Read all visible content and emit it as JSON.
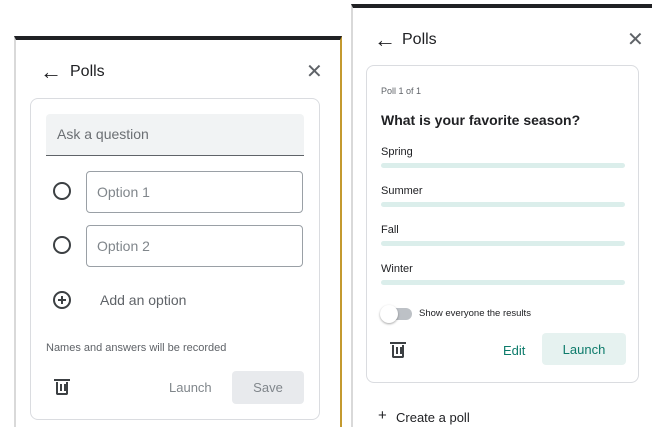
{
  "left_panel": {
    "title": "Polls",
    "back_icon": "←",
    "close_icon": "✕",
    "question_placeholder": "Ask a question",
    "options": [
      "Option 1",
      "Option 2"
    ],
    "add_option_label": "Add an option",
    "note": "Names and answers will be recorded",
    "launch_label": "Launch",
    "save_label": "Save"
  },
  "right_panel": {
    "title": "Polls",
    "back_icon": "←",
    "close_icon": "✕",
    "poll_counter": "Poll 1 of 1",
    "question": "What is your favorite season?",
    "options": [
      {
        "label": "Spring",
        "fraction": 0
      },
      {
        "label": "Summer",
        "fraction": 0
      },
      {
        "label": "Fall",
        "fraction": 0
      },
      {
        "label": "Winter",
        "fraction": 0
      }
    ],
    "show_results_label": "Show everyone the results",
    "show_results_on": false,
    "edit_label": "Edit",
    "launch_label": "Launch",
    "create_poll_label": "Create a poll",
    "create_icon": "+"
  },
  "colors": {
    "accent_teal": "#0d7b6b",
    "launch_bg": "#e6f2f0",
    "save_bg": "#e8eaed",
    "bar_bg": "#dbeeeb"
  }
}
